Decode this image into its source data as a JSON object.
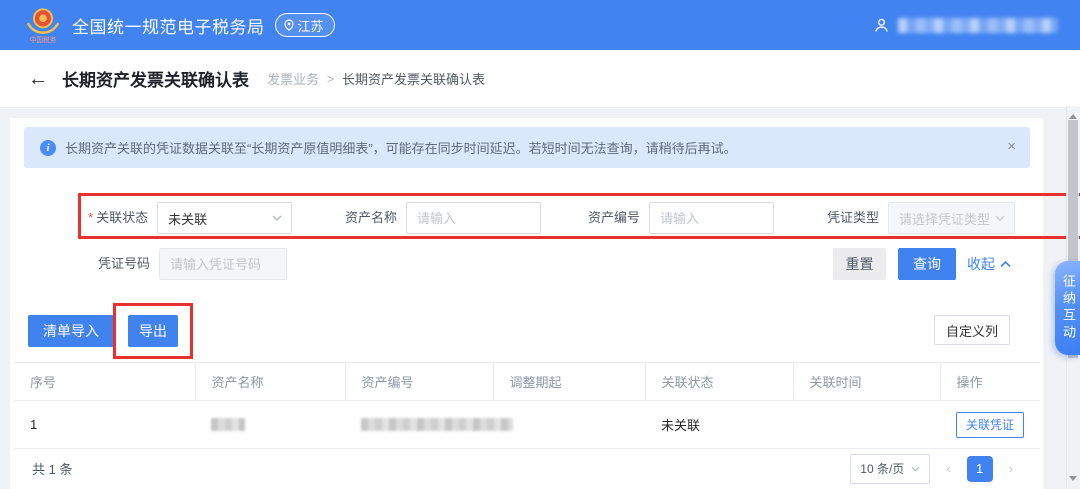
{
  "header": {
    "app_title": "全国统一规范电子税务局",
    "location": "江苏"
  },
  "icons": {
    "back_arrow": "←",
    "close": "×",
    "separator": ">",
    "info": "i",
    "prev": "‹",
    "next": "›"
  },
  "breadcrumb": {
    "page_title": "长期资产发票关联确认表",
    "section": "发票业务",
    "current": "长期资产发票关联确认表"
  },
  "banner": {
    "text": "长期资产关联的凭证数据关联至“长期资产原值明细表”，可能存在同步时间延迟。若短时间无法查询，请稍待后再试。"
  },
  "filters": {
    "link_status": {
      "label": "关联状态",
      "required_mark": "*",
      "value": "未关联"
    },
    "asset_name": {
      "label": "资产名称",
      "placeholder": "请输入"
    },
    "asset_code": {
      "label": "资产编号",
      "placeholder": "请输入"
    },
    "voucher_type": {
      "label": "凭证类型",
      "placeholder": "请选择凭证类型"
    },
    "voucher_no": {
      "label": "凭证号码",
      "placeholder": "请输入凭证号码"
    },
    "reset_label": "重置",
    "query_label": "查询",
    "collapse_label": "收起"
  },
  "actions": {
    "import_label": "清单导入",
    "export_label": "导出",
    "customize_label": "自定义列"
  },
  "table": {
    "columns": [
      "序号",
      "资产名称",
      "资产编号",
      "调整期起",
      "关联状态",
      "关联时间",
      "操作"
    ],
    "row": {
      "index": "1",
      "link_status": "未关联",
      "action_label": "关联凭证"
    }
  },
  "pagination": {
    "total": "共 1 条",
    "page_size": "10 条/页",
    "current_page": "1"
  },
  "side_tab": {
    "label": "征纳互动"
  },
  "colors": {
    "primary": "#4083ef",
    "header_blue": "#4183f1",
    "annotation_red": "#e8302e",
    "banner_bg": "#d9e8fb"
  }
}
